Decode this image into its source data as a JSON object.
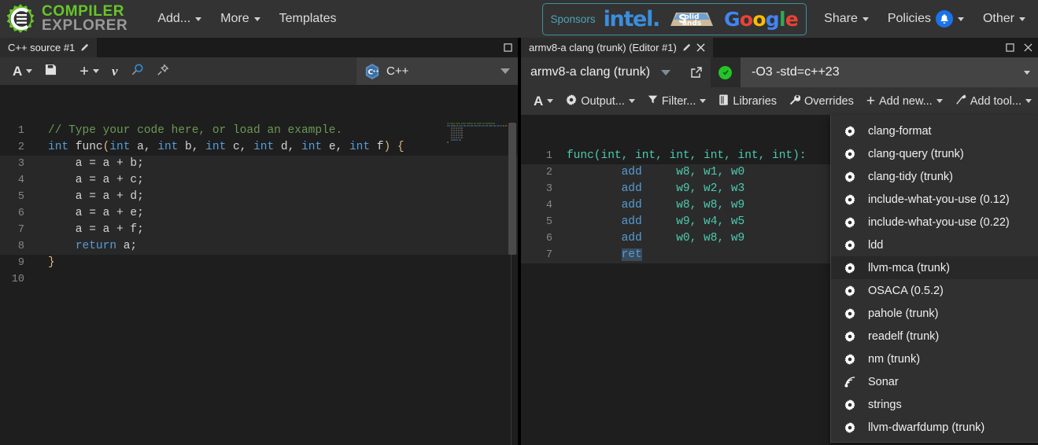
{
  "navbar": {
    "logo_line1": "COMPILER",
    "logo_line2": "EXPLORER",
    "items": [
      {
        "label": "Add...",
        "has_caret": true,
        "name": "nav-add"
      },
      {
        "label": "More",
        "has_caret": true,
        "name": "nav-more"
      },
      {
        "label": "Templates",
        "has_caret": false,
        "name": "nav-templates"
      }
    ],
    "sponsors": {
      "label": "Sponsors",
      "intel": "intel.",
      "solidsands_l1": "olid",
      "solidsands_l2": "ands",
      "solidsands_s": "S",
      "google": [
        "G",
        "o",
        "o",
        "g",
        "l",
        "e"
      ]
    },
    "right_items": [
      {
        "label": "Share",
        "has_caret": true,
        "name": "nav-share"
      },
      {
        "label": "Policies",
        "has_caret": true,
        "badge": "bell",
        "name": "nav-policies"
      },
      {
        "label": "Other",
        "has_caret": true,
        "name": "nav-other"
      }
    ]
  },
  "editor_pane": {
    "tab_title": "C++ source #1",
    "toolbar": [
      {
        "icon": "font-size-icon",
        "label": "A",
        "caret": true,
        "name": "font-size-button"
      },
      {
        "icon": "save-icon",
        "label": "",
        "caret": false,
        "name": "save-button"
      },
      {
        "icon": "add-icon",
        "label": "",
        "caret": true,
        "name": "add-button"
      },
      {
        "icon": "vim-icon",
        "label": "",
        "caret": false,
        "name": "vim-mode-button"
      },
      {
        "icon": "search-icon",
        "label": "",
        "caret": false,
        "name": "search-button"
      },
      {
        "icon": "pin-icon",
        "label": "",
        "caret": false,
        "name": "pin-button"
      }
    ],
    "language": "C++",
    "code_lines": [
      {
        "n": 1,
        "hl": false,
        "tokens": [
          {
            "t": "// Type your code here, or load an example.",
            "c": "t-comment"
          }
        ]
      },
      {
        "n": 2,
        "hl": false,
        "tokens": [
          {
            "t": "int",
            "c": "t-key"
          },
          {
            "t": " ",
            "c": "t-plain"
          },
          {
            "t": "func",
            "c": "t-plain"
          },
          {
            "t": "(",
            "c": "t-brace"
          },
          {
            "t": "int",
            "c": "t-key"
          },
          {
            "t": " a, ",
            "c": "t-plain"
          },
          {
            "t": "int",
            "c": "t-key"
          },
          {
            "t": " b, ",
            "c": "t-plain"
          },
          {
            "t": "int",
            "c": "t-key"
          },
          {
            "t": " c, ",
            "c": "t-plain"
          },
          {
            "t": "int",
            "c": "t-key"
          },
          {
            "t": " d, ",
            "c": "t-plain"
          },
          {
            "t": "int",
            "c": "t-key"
          },
          {
            "t": " e, ",
            "c": "t-plain"
          },
          {
            "t": "int",
            "c": "t-key"
          },
          {
            "t": " f",
            "c": "t-plain"
          },
          {
            "t": ")",
            "c": "t-brace"
          },
          {
            "t": " ",
            "c": "t-plain"
          },
          {
            "t": "{",
            "c": "t-brace"
          }
        ]
      },
      {
        "n": 3,
        "hl": true,
        "tokens": [
          {
            "t": "    a = a + b;",
            "c": "t-plain"
          }
        ]
      },
      {
        "n": 4,
        "hl": true,
        "tokens": [
          {
            "t": "    a = a + c;",
            "c": "t-plain"
          }
        ]
      },
      {
        "n": 5,
        "hl": true,
        "tokens": [
          {
            "t": "    a = a + d;",
            "c": "t-plain"
          }
        ]
      },
      {
        "n": 6,
        "hl": true,
        "tokens": [
          {
            "t": "    a = a + e;",
            "c": "t-plain"
          }
        ]
      },
      {
        "n": 7,
        "hl": true,
        "tokens": [
          {
            "t": "    a = a + f;",
            "c": "t-plain"
          }
        ]
      },
      {
        "n": 8,
        "hl": true,
        "tokens": [
          {
            "t": "    ",
            "c": "t-plain"
          },
          {
            "t": "return",
            "c": "t-key"
          },
          {
            "t": " a;",
            "c": "t-plain"
          }
        ]
      },
      {
        "n": 9,
        "hl": false,
        "tokens": [
          {
            "t": "}",
            "c": "t-brace"
          }
        ]
      },
      {
        "n": 10,
        "hl": false,
        "tokens": [
          {
            "t": "",
            "c": "t-plain"
          }
        ]
      }
    ]
  },
  "compiler_pane": {
    "tab_title": "armv8-a clang (trunk) (Editor #1)",
    "compiler_name": "armv8-a clang (trunk)",
    "options_value": "-O3 -std=c++23",
    "status": "ok",
    "toolbar": [
      {
        "icon": "font-size-icon",
        "label": "A",
        "caret": true,
        "name": "asm-font-size-button"
      },
      {
        "icon": "gear-icon",
        "label": "Output...",
        "caret": true,
        "name": "output-button"
      },
      {
        "icon": "filter-icon",
        "label": "Filter...",
        "caret": true,
        "name": "filter-button"
      },
      {
        "icon": "book-icon",
        "label": "Libraries",
        "caret": false,
        "name": "libraries-button"
      },
      {
        "icon": "wrench-icon",
        "label": "Overrides",
        "caret": false,
        "name": "overrides-button"
      },
      {
        "icon": "plus-icon",
        "label": "Add new...",
        "caret": true,
        "name": "add-new-button"
      },
      {
        "icon": "tool-icon",
        "label": "Add tool...",
        "caret": true,
        "name": "add-tool-button"
      }
    ],
    "asm_lines": [
      {
        "n": 1,
        "hl": false,
        "tokens": [
          {
            "t": "func(int, int, int, int, int, int):",
            "c": "t-label"
          }
        ]
      },
      {
        "n": 2,
        "hl": true,
        "tokens": [
          {
            "t": "        ",
            "c": "t-plain"
          },
          {
            "t": "add",
            "c": "t-op"
          },
          {
            "t": "     ",
            "c": "t-plain"
          },
          {
            "t": "w8, w1, w0",
            "c": "t-reg"
          }
        ]
      },
      {
        "n": 3,
        "hl": true,
        "tokens": [
          {
            "t": "        ",
            "c": "t-plain"
          },
          {
            "t": "add",
            "c": "t-op"
          },
          {
            "t": "     ",
            "c": "t-plain"
          },
          {
            "t": "w9, w2, w3",
            "c": "t-reg"
          }
        ]
      },
      {
        "n": 4,
        "hl": true,
        "tokens": [
          {
            "t": "        ",
            "c": "t-plain"
          },
          {
            "t": "add",
            "c": "t-op"
          },
          {
            "t": "     ",
            "c": "t-plain"
          },
          {
            "t": "w8, w8, w9",
            "c": "t-reg"
          }
        ]
      },
      {
        "n": 5,
        "hl": true,
        "tokens": [
          {
            "t": "        ",
            "c": "t-plain"
          },
          {
            "t": "add",
            "c": "t-op"
          },
          {
            "t": "     ",
            "c": "t-plain"
          },
          {
            "t": "w9, w4, w5",
            "c": "t-reg"
          }
        ]
      },
      {
        "n": 6,
        "hl": true,
        "tokens": [
          {
            "t": "        ",
            "c": "t-plain"
          },
          {
            "t": "add",
            "c": "t-op"
          },
          {
            "t": "     ",
            "c": "t-plain"
          },
          {
            "t": "w0, w8, w9",
            "c": "t-reg"
          }
        ]
      },
      {
        "n": 7,
        "hl": true,
        "tokens": [
          {
            "t": "        ",
            "c": "t-plain"
          },
          {
            "t": "ret",
            "c": "t-op t-sel"
          }
        ]
      }
    ]
  },
  "tools_menu": {
    "items": [
      {
        "label": "clang-format",
        "icon": "gear-icon",
        "active": false
      },
      {
        "label": "clang-query (trunk)",
        "icon": "gear-icon",
        "active": false
      },
      {
        "label": "clang-tidy (trunk)",
        "icon": "gear-icon",
        "active": false
      },
      {
        "label": "include-what-you-use (0.12)",
        "icon": "gear-icon",
        "active": false
      },
      {
        "label": "include-what-you-use (0.22)",
        "icon": "gear-icon",
        "active": false
      },
      {
        "label": "ldd",
        "icon": "gear-icon",
        "active": false
      },
      {
        "label": "llvm-mca (trunk)",
        "icon": "gear-icon",
        "active": true
      },
      {
        "label": "OSACA (0.5.2)",
        "icon": "gear-icon",
        "active": false
      },
      {
        "label": "pahole (trunk)",
        "icon": "gear-icon",
        "active": false
      },
      {
        "label": "readelf (trunk)",
        "icon": "gear-icon",
        "active": false
      },
      {
        "label": "nm (trunk)",
        "icon": "gear-icon",
        "active": false
      },
      {
        "label": "Sonar",
        "icon": "sonar-icon",
        "active": false
      },
      {
        "label": "strings",
        "icon": "gear-icon",
        "active": false
      },
      {
        "label": "llvm-dwarfdump (trunk)",
        "icon": "gear-icon",
        "active": false
      }
    ]
  },
  "colors": {
    "navbar_bg": "#333333",
    "accent_green": "#67c52a",
    "status_green": "#24c328",
    "sponsor_border": "#3e8f9e",
    "editor_bg": "#1e1e1e",
    "menu_bg": "#303030"
  }
}
